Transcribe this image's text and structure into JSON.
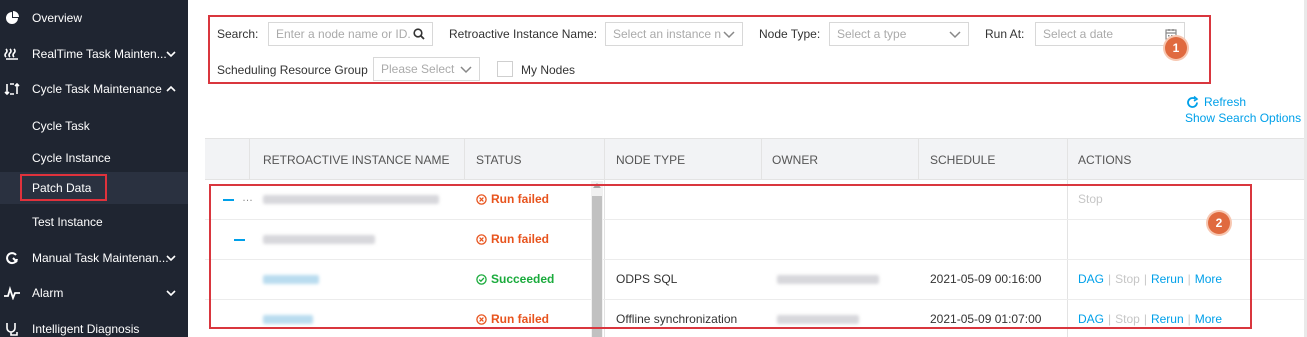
{
  "sidebar": {
    "items": [
      {
        "label": "Overview",
        "icon": "pie-chart-icon"
      },
      {
        "label": "RealTime Task Mainten...",
        "icon": "waves-icon",
        "chevron": "chevron-down-icon"
      },
      {
        "label": "Cycle Task Maintenance",
        "icon": "cycle-icon",
        "chevron": "chevron-up-icon"
      },
      {
        "label": "Manual Task Maintenan...",
        "icon": "manual-icon",
        "chevron": "chevron-down-icon"
      },
      {
        "label": "Alarm",
        "icon": "pulse-icon",
        "chevron": "chevron-down-icon"
      },
      {
        "label": "Intelligent Diagnosis",
        "icon": "stethoscope-icon"
      }
    ],
    "sub_items": [
      {
        "label": "Cycle Task"
      },
      {
        "label": "Cycle Instance"
      },
      {
        "label": "Patch Data",
        "active": true
      },
      {
        "label": "Test Instance"
      }
    ]
  },
  "filters": {
    "search_label": "Search:",
    "search_placeholder": "Enter a node name or ID.",
    "retro_label": "Retroactive Instance Name:",
    "retro_placeholder": "Select an instance n",
    "node_type_label": "Node Type:",
    "node_type_placeholder": "Select a type",
    "run_at_label": "Run At:",
    "run_at_placeholder": "Select a date",
    "resource_group_label": "Scheduling Resource Group",
    "resource_group_placeholder": "Please Select",
    "my_nodes_label": "My Nodes",
    "badge": "1"
  },
  "toolbar": {
    "refresh_label": "Refresh",
    "show_search_options_label": "Show Search Options"
  },
  "table": {
    "headers": [
      "RETROACTIVE INSTANCE NAME",
      "STATUS",
      "NODE TYPE",
      "OWNER",
      "SCHEDULE",
      "ACTIONS"
    ],
    "badge": "2",
    "rows": [
      {
        "level": 0,
        "status": "Run failed",
        "status_kind": "failed",
        "node_type": "",
        "schedule": "",
        "actions": [
          "Stop"
        ]
      },
      {
        "level": 1,
        "status": "Run failed",
        "status_kind": "failed",
        "node_type": "",
        "schedule": "",
        "actions": []
      },
      {
        "level": 2,
        "status": "Succeeded",
        "status_kind": "ok",
        "node_type": "ODPS SQL",
        "schedule": "2021-05-09 00:16:00",
        "actions": [
          "DAG",
          "Stop",
          "Rerun",
          "More"
        ]
      },
      {
        "level": 2,
        "status": "Run failed",
        "status_kind": "failed",
        "node_type": "Offline synchronization",
        "schedule": "2021-05-09 01:07:00",
        "actions": [
          "DAG",
          "Stop",
          "Rerun",
          "More"
        ]
      }
    ]
  },
  "colors": {
    "accent": "#00a0e9",
    "failed": "#e8541e",
    "success": "#1aab3c",
    "sidebar_bg": "#1f2531",
    "highlight": "#d9363e"
  }
}
